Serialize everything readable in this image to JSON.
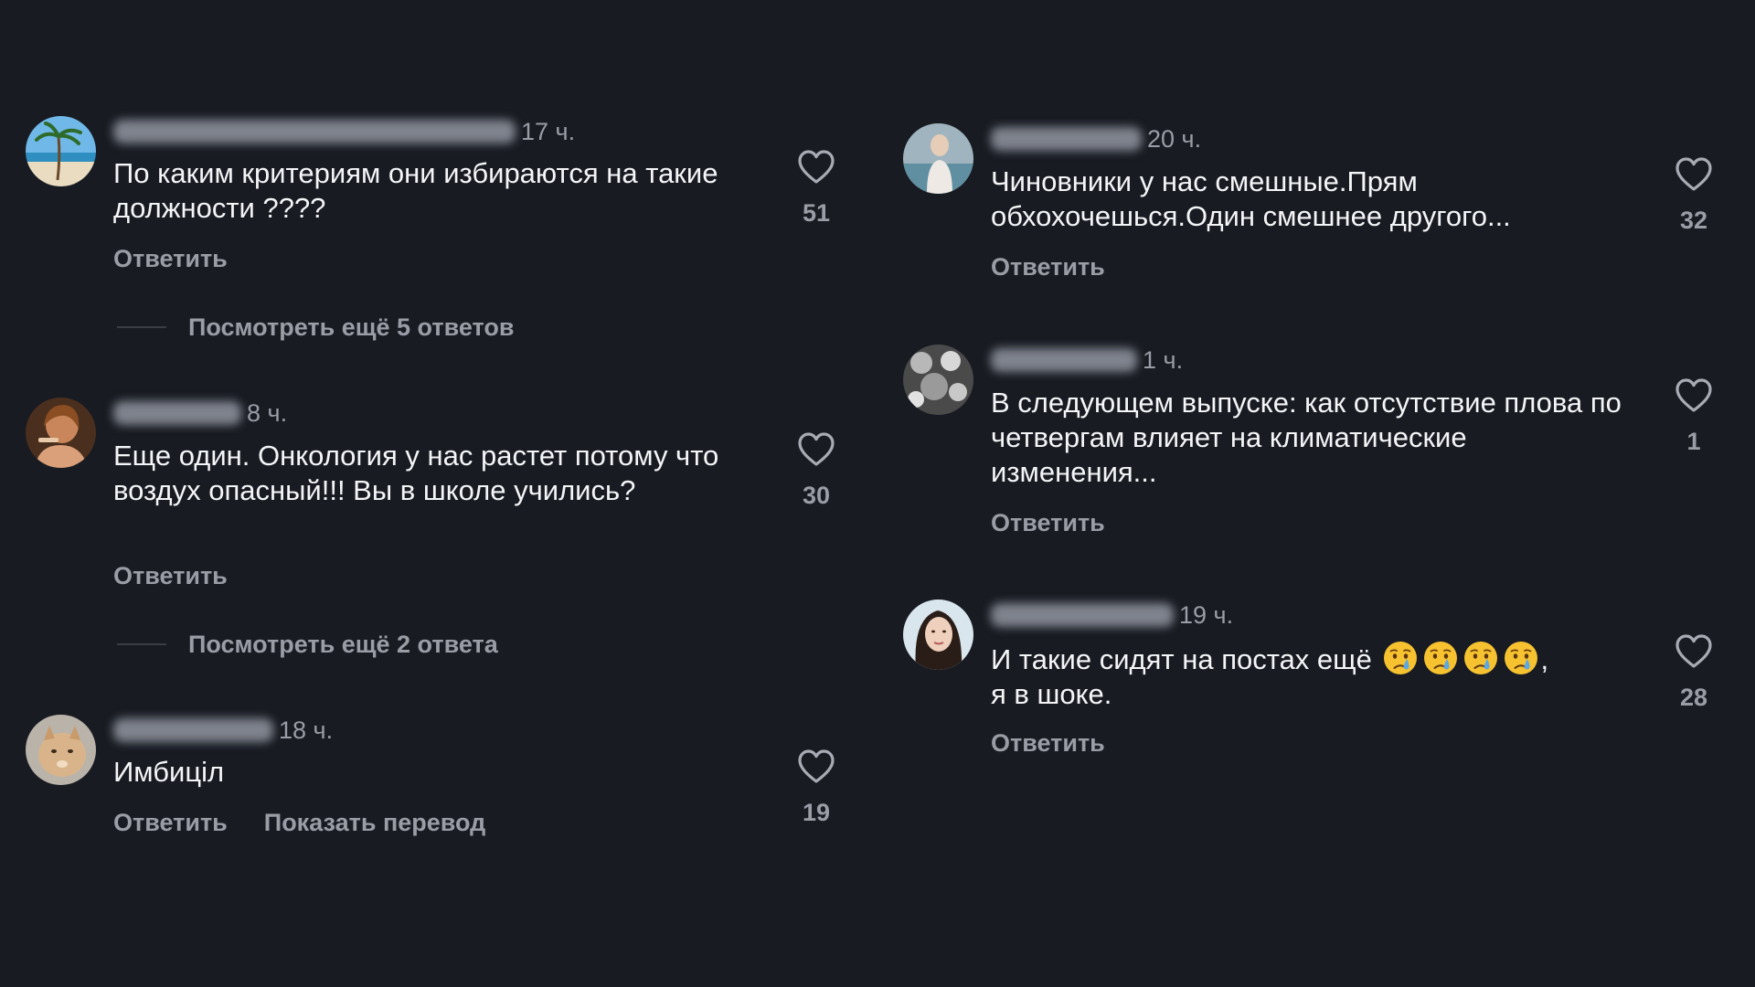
{
  "left_column": {
    "comments": [
      {
        "time": "17 ч.",
        "text": "По каким критериям они избираются на такие должности ????",
        "reply": "Ответить",
        "likes": "51",
        "view_more": "Посмотреть ещё 5 ответов"
      },
      {
        "time": "8 ч.",
        "text": "Еще один. Онкология у нас растет потому что воздух  опасный!!! Вы в школе учились?",
        "reply": "Ответить",
        "likes": "30",
        "view_more": "Посмотреть ещё 2 ответа"
      },
      {
        "time": "18 ч.",
        "text": "Имбицiл",
        "reply": "Ответить",
        "translate": "Показать перевод",
        "likes": "19"
      }
    ]
  },
  "right_column": {
    "comments": [
      {
        "time": "20 ч.",
        "text": "Чиновники у нас смешные.Прям обхохочешься.Один смешнее другого...",
        "reply": "Ответить",
        "likes": "32"
      },
      {
        "time": "1 ч.",
        "text": "В следующем выпуске: как отсутствие плова по четвергам влияет на климатические изменения...",
        "reply": "Ответить",
        "likes": "1"
      },
      {
        "time": "19 ч.",
        "text_start": "И такие сидят на постах ещё",
        "text_punct": ",",
        "text_end": "я в шоке.",
        "emoji": [
          "crying-face",
          "crying-face",
          "crying-face",
          "crying-face"
        ],
        "reply": "Ответить",
        "likes": "28"
      }
    ]
  },
  "colors": {
    "background": "#181b22",
    "text": "#f4f5f7",
    "muted": "#9a9da6",
    "emoji_face": "#f6c230",
    "emoji_tear": "#5aa8e8"
  },
  "icons": {
    "like": "heart-outline-icon",
    "emoji": "crying-face-icon"
  }
}
